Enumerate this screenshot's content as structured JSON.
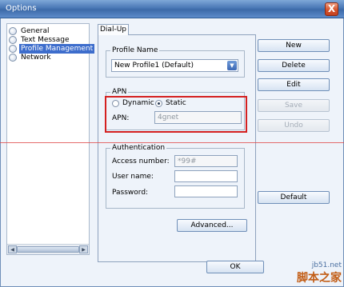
{
  "window": {
    "title": "Options",
    "close_glyph": "X"
  },
  "tree": {
    "items": [
      {
        "label": "General",
        "selected": false
      },
      {
        "label": "Text Message",
        "selected": false
      },
      {
        "label": "Profile Management",
        "selected": true
      },
      {
        "label": "Network",
        "selected": false
      }
    ]
  },
  "scroll": {
    "left_glyph": "◀",
    "right_glyph": "▶"
  },
  "tab": {
    "label": "Dial-Up"
  },
  "profile_name": {
    "legend": "Profile Name",
    "selected": "New Profile1 (Default)",
    "arrow_glyph": "▼"
  },
  "apn": {
    "legend": "APN",
    "dynamic_label": "Dynamic",
    "static_label": "Static",
    "selected_mode": "Static",
    "field_label": "APN:",
    "value": "4gnet"
  },
  "auth": {
    "legend": "Authentication",
    "access_number_label": "Access number:",
    "access_number_value": "*99#",
    "user_name_label": "User name:",
    "user_name_value": "",
    "password_label": "Password:",
    "password_value": ""
  },
  "buttons": {
    "new": "New",
    "delete": "Delete",
    "edit": "Edit",
    "save": "Save",
    "undo": "Undo",
    "default": "Default",
    "advanced": "Advanced...",
    "ok": "OK"
  },
  "watermark": {
    "site": "jb51.net",
    "brand": "脚本之家"
  },
  "colors": {
    "highlight": "#d42020",
    "selection": "#3d6dcc",
    "title_bar": "#4a78b6"
  }
}
